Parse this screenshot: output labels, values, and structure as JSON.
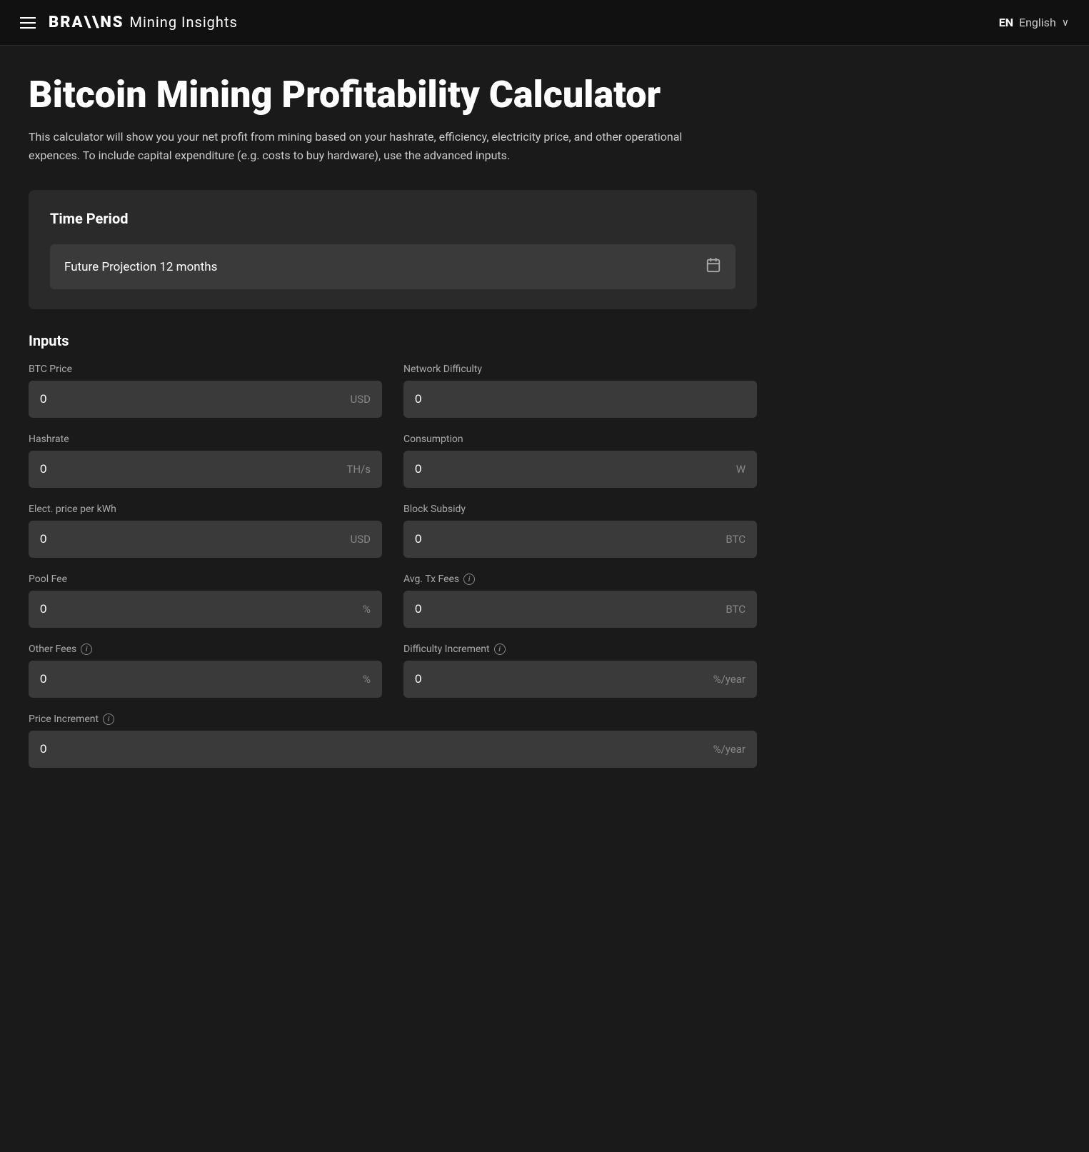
{
  "navbar": {
    "menu_icon_label": "menu",
    "brand_name": "BRA\\\\NS",
    "app_name": "Mining Insights",
    "lang_code": "EN",
    "lang_name": "English",
    "chevron": "∨"
  },
  "page": {
    "title": "Bitcoin Mining Profitability Calculator",
    "description": "This calculator will show you your net profit from mining based on your hashrate, efficiency, electricity price, and other operational expences. To include capital expenditure (e.g. costs to buy hardware), use the advanced inputs."
  },
  "time_period": {
    "section_title": "Time Period",
    "selector_label": "Future Projection 12 months",
    "calendar_icon": "📅"
  },
  "inputs": {
    "section_title": "Inputs",
    "fields": [
      {
        "id": "btc-price",
        "label": "BTC Price",
        "value": "0",
        "unit": "USD",
        "has_info": false,
        "full_width": false
      },
      {
        "id": "network-difficulty",
        "label": "Network Difficulty",
        "value": "0",
        "unit": "",
        "has_info": false,
        "full_width": false
      },
      {
        "id": "hashrate",
        "label": "Hashrate",
        "value": "0",
        "unit": "TH/s",
        "has_info": false,
        "full_width": false
      },
      {
        "id": "consumption",
        "label": "Consumption",
        "value": "0",
        "unit": "W",
        "has_info": false,
        "full_width": false
      },
      {
        "id": "elect-price",
        "label": "Elect. price per kWh",
        "value": "0",
        "unit": "USD",
        "has_info": false,
        "full_width": false
      },
      {
        "id": "block-subsidy",
        "label": "Block Subsidy",
        "value": "0",
        "unit": "BTC",
        "has_info": false,
        "full_width": false
      },
      {
        "id": "pool-fee",
        "label": "Pool Fee",
        "value": "0",
        "unit": "%",
        "has_info": false,
        "full_width": false
      },
      {
        "id": "avg-tx-fees",
        "label": "Avg. Tx Fees",
        "value": "0",
        "unit": "BTC",
        "has_info": true,
        "full_width": false
      },
      {
        "id": "other-fees",
        "label": "Other Fees",
        "value": "0",
        "unit": "%",
        "has_info": true,
        "full_width": false
      },
      {
        "id": "difficulty-increment",
        "label": "Difficulty Increment",
        "value": "0",
        "unit": "%/year",
        "has_info": true,
        "full_width": false
      },
      {
        "id": "price-increment",
        "label": "Price Increment",
        "value": "0",
        "unit": "%/year",
        "has_info": true,
        "full_width": true
      }
    ],
    "info_symbol": "i"
  }
}
